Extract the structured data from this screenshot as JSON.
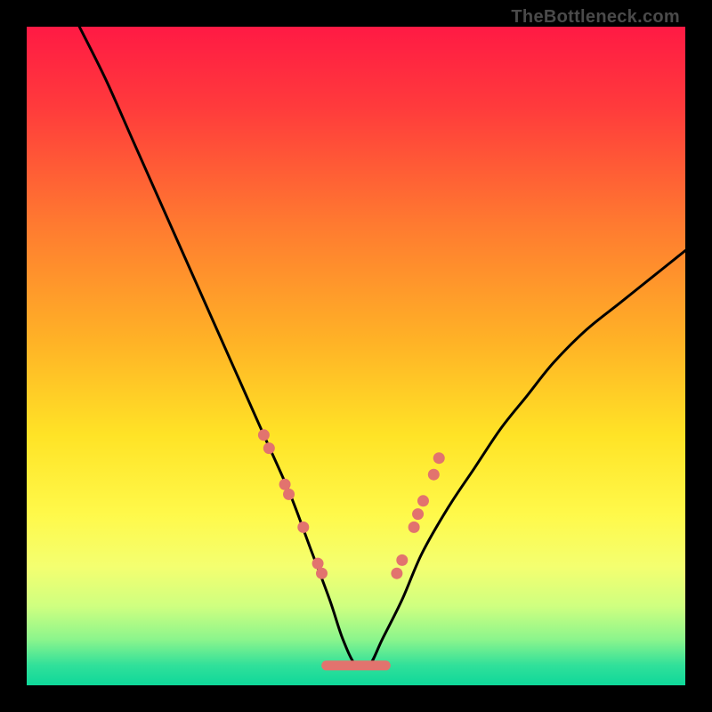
{
  "watermark": "TheBottleneck.com",
  "chart_data": {
    "type": "line",
    "title": "",
    "xlabel": "",
    "ylabel": "",
    "xlim": [
      0,
      100
    ],
    "ylim": [
      0,
      100
    ],
    "grid": false,
    "legend": false,
    "gradient_stops": [
      {
        "offset": 0.0,
        "color": "#ff1a44"
      },
      {
        "offset": 0.12,
        "color": "#ff3a3c"
      },
      {
        "offset": 0.3,
        "color": "#ff7a30"
      },
      {
        "offset": 0.48,
        "color": "#ffb326"
      },
      {
        "offset": 0.62,
        "color": "#ffe326"
      },
      {
        "offset": 0.74,
        "color": "#fff94a"
      },
      {
        "offset": 0.82,
        "color": "#f4ff70"
      },
      {
        "offset": 0.88,
        "color": "#cfff80"
      },
      {
        "offset": 0.93,
        "color": "#8cf58c"
      },
      {
        "offset": 0.97,
        "color": "#30e09a"
      },
      {
        "offset": 1.0,
        "color": "#0fd89a"
      }
    ],
    "series": [
      {
        "name": "bottleneck-curve",
        "type": "line",
        "color": "#000000",
        "x": [
          8,
          12,
          16,
          20,
          24,
          28,
          32,
          36,
          40,
          43,
          46,
          48,
          50,
          52,
          54,
          57,
          60,
          64,
          68,
          72,
          76,
          80,
          85,
          90,
          95,
          100
        ],
        "y": [
          100,
          92,
          83,
          74,
          65,
          56,
          47,
          38,
          29,
          21,
          13,
          7,
          3,
          3,
          7,
          13,
          20,
          27,
          33,
          39,
          44,
          49,
          54,
          58,
          62,
          66
        ]
      },
      {
        "name": "optimal-band",
        "type": "segment",
        "color": "#e2736e",
        "x": [
          45.5,
          54.5
        ],
        "y": [
          3,
          3
        ]
      },
      {
        "name": "markers-left",
        "type": "scatter",
        "color": "#e2736e",
        "x": [
          36.0,
          36.8,
          39.2,
          39.8,
          42.0,
          44.2,
          44.8
        ],
        "y": [
          38.0,
          36.0,
          30.5,
          29.0,
          24.0,
          18.5,
          17.0
        ]
      },
      {
        "name": "markers-right",
        "type": "scatter",
        "color": "#e2736e",
        "x": [
          56.2,
          57.0,
          58.8,
          59.4,
          60.2,
          61.8,
          62.6
        ],
        "y": [
          17.0,
          19.0,
          24.0,
          26.0,
          28.0,
          32.0,
          34.5
        ]
      }
    ]
  }
}
